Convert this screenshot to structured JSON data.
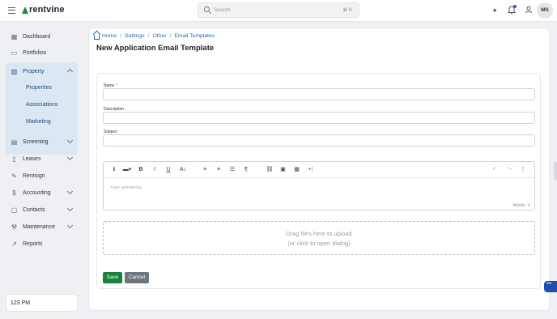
{
  "app": {
    "logo_text": "rentvine",
    "brand_color": "#1e8a3e"
  },
  "header": {
    "search_placeholder": "Search",
    "search_shortcut": "⌘ K",
    "avatar_initials": "MS"
  },
  "sidebar": {
    "items": [
      {
        "label": "Dashboard",
        "icon": "grid-icon"
      },
      {
        "label": "Portfolios",
        "icon": "folder-icon"
      },
      {
        "label": "Property",
        "icon": "building-icon"
      },
      {
        "label": "Screening",
        "icon": "document-icon"
      },
      {
        "label": "Leases",
        "icon": "file-icon"
      },
      {
        "label": "Rentsign",
        "icon": "pen-icon"
      },
      {
        "label": "Accounting",
        "icon": "dollar-icon"
      },
      {
        "label": "Contacts",
        "icon": "book-icon"
      },
      {
        "label": "Maintenance",
        "icon": "wrench-icon"
      },
      {
        "label": "Reports",
        "icon": "chart-icon"
      }
    ],
    "property_subitems": [
      "Properties",
      "Associations",
      "Marketing"
    ],
    "time": "123 PM"
  },
  "breadcrumb": [
    "Home",
    "Settings",
    "Other",
    "Email Templates"
  ],
  "page": {
    "title": "New Application Email Template"
  },
  "form": {
    "name_label": "Name",
    "name_required_marker": "*",
    "description_label": "Description",
    "subject_label": "Subject",
    "editor_placeholder": "Type something",
    "word_count": "Words : 0",
    "dropzone_line1": "Drag files here to upload",
    "dropzone_line2": "(or click to open dialog)",
    "save_label": "Save",
    "cancel_label": "Cancel"
  },
  "toolbar_icons": {
    "info": "ℹ",
    "bold": "B",
    "italic": "I",
    "underline": "U",
    "font_size": "A↕",
    "paragraph": "¶",
    "more": "⋮"
  }
}
